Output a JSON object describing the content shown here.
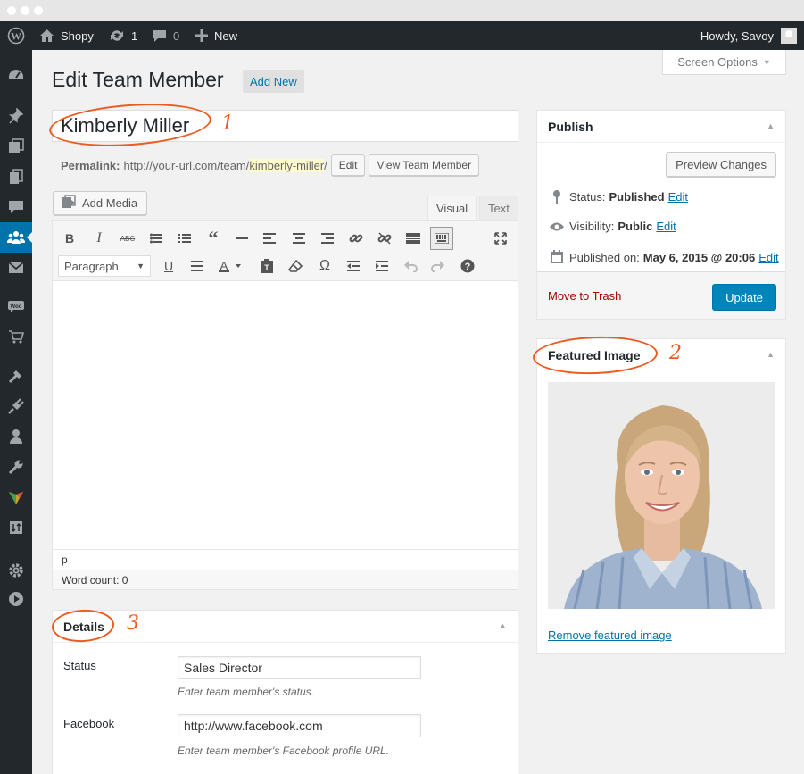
{
  "adminbar": {
    "site_name": "Shopy",
    "updates_count": "1",
    "comments_count": "0",
    "new_label": "New",
    "howdy": "Howdy, Savoy"
  },
  "menu": {
    "icons": [
      "dashboard-icon",
      "pin-icon",
      "media-icon",
      "pages-icon",
      "comments-icon",
      "team-icon",
      "mail-icon",
      "woo-icon",
      "cart-icon",
      "appearance-icon",
      "plugins-icon",
      "users-icon",
      "tools-icon",
      "theme-icon",
      "import-icon",
      "settings-icon",
      "play-icon"
    ],
    "active": "team-icon"
  },
  "screen_options": "Screen Options",
  "page": {
    "title": "Edit Team Member",
    "add_new": "Add New"
  },
  "post": {
    "title": "Kimberly Miller",
    "permalink_label": "Permalink:",
    "permalink_base": "http://your-url.com/team/",
    "permalink_slug": "kimberly-miller",
    "permalink_trail": "/",
    "edit_btn": "Edit",
    "view_btn": "View Team Member"
  },
  "editor": {
    "add_media": "Add Media",
    "tab_visual": "Visual",
    "tab_text": "Text",
    "format": "Paragraph",
    "path": "p",
    "word_count": "Word count: 0"
  },
  "details": {
    "heading": "Details",
    "fields": [
      {
        "label": "Status",
        "value": "Sales Director",
        "desc": "Enter team member's status."
      },
      {
        "label": "Facebook",
        "value": "http://www.facebook.com",
        "desc": "Enter team member's Facebook profile URL."
      }
    ]
  },
  "publish": {
    "heading": "Publish",
    "preview": "Preview Changes",
    "status_label": "Status:",
    "status_value": "Published",
    "visibility_label": "Visibility:",
    "visibility_value": "Public",
    "published_label": "Published on:",
    "published_value": "May 6, 2015 @ 20:06",
    "edit": "Edit",
    "trash": "Move to Trash",
    "update": "Update"
  },
  "featured": {
    "heading": "Featured Image",
    "remove": "Remove featured image"
  },
  "annotations": [
    "1",
    "2",
    "3"
  ],
  "colors": {
    "accent": "#0073aa",
    "update_button": "#0085ba",
    "annotation": "#ee5a1e",
    "adminbar": "#23282d"
  }
}
